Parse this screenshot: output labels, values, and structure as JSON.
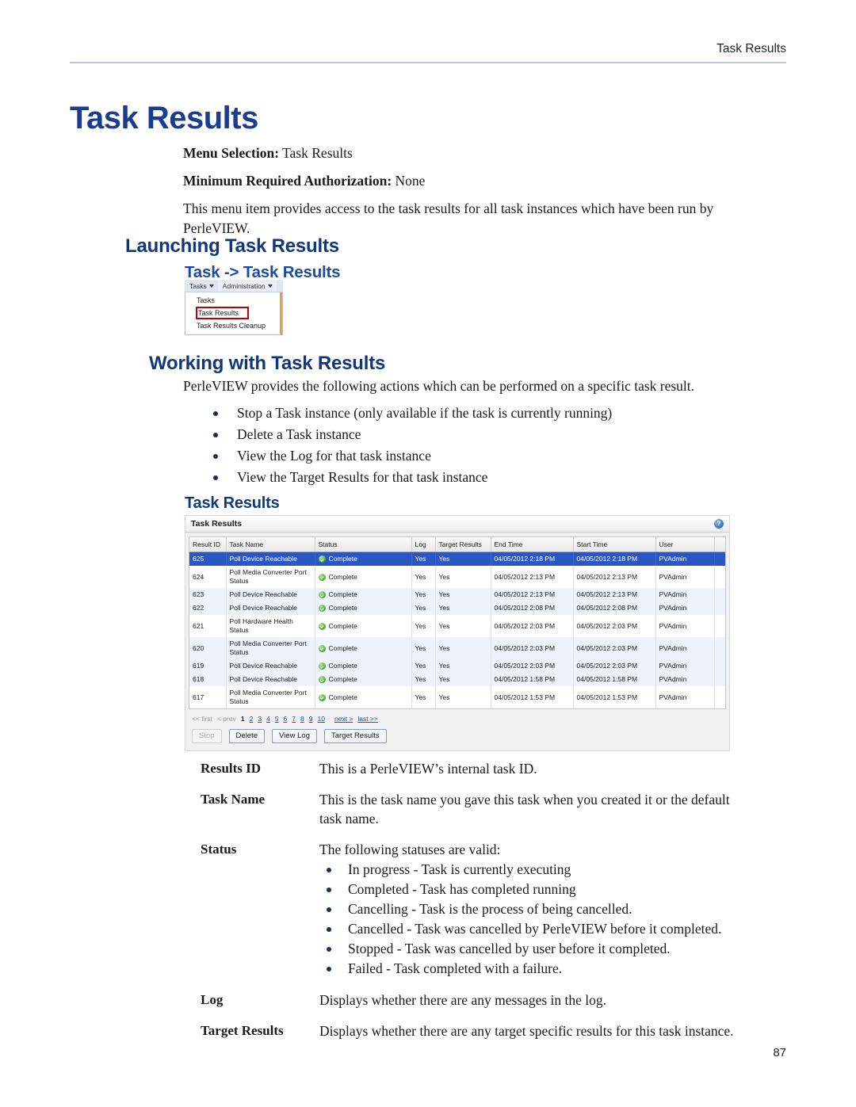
{
  "header": {
    "running_head": "Task Results"
  },
  "chapter": {
    "title": "Task Results"
  },
  "intro": {
    "menu_selection_label": "Menu Selection:",
    "menu_selection_value": " Task Results",
    "authorization_label": "Minimum Required Authorization:",
    "authorization_value": " None",
    "description": "This menu item provides access to the task results for all task instances which have been run by PerleVIEW."
  },
  "sections": {
    "launching": "Launching Task Results",
    "nav_path": "Task -> Task Results",
    "working_with": "Working with Task Results",
    "task_results": "Task Results"
  },
  "menu_mock": {
    "menubar": [
      {
        "label": "Tasks",
        "has_caret": true
      },
      {
        "label": "Administration",
        "has_caret": true
      }
    ],
    "dropdown_items": [
      {
        "label": "Tasks",
        "highlighted": false
      },
      {
        "label": "Task Results",
        "highlighted": true
      },
      {
        "label": "Task Results Cleanup",
        "highlighted": false
      }
    ],
    "highlight_color": "#c00000"
  },
  "working_with": {
    "lead": "PerleVIEW provides the following actions which can be performed on a specific task result.",
    "actions": [
      "Stop a Task instance (only available if the task is currently running)",
      "Delete a Task instance",
      "View the Log for that task instance",
      "View the Target Results for that task instance"
    ]
  },
  "app_shot": {
    "panel_title": "Task Results",
    "help_icon_glyph": "?",
    "columns": [
      "Result ID",
      "Task Name",
      "Status",
      "Log",
      "Target Results",
      "End Time",
      "Start Time",
      "User"
    ],
    "rows": [
      {
        "result_id": "625",
        "task_name": "Poll Device Reachable",
        "status": "Complete",
        "log": "Yes",
        "target_results": "Yes",
        "end_time": "04/05/2012 2:18 PM",
        "start_time": "04/05/2012 2:18 PM",
        "user": "PVAdmin",
        "selected": true
      },
      {
        "result_id": "624",
        "task_name": "Poll Media Converter Port Status",
        "status": "Complete",
        "log": "Yes",
        "target_results": "Yes",
        "end_time": "04/05/2012 2:13 PM",
        "start_time": "04/05/2012 2:13 PM",
        "user": "PVAdmin",
        "selected": false
      },
      {
        "result_id": "623",
        "task_name": "Poll Device Reachable",
        "status": "Complete",
        "log": "Yes",
        "target_results": "Yes",
        "end_time": "04/05/2012 2:13 PM",
        "start_time": "04/05/2012 2:13 PM",
        "user": "PVAdmin",
        "selected": false
      },
      {
        "result_id": "622",
        "task_name": "Poll Device Reachable",
        "status": "Complete",
        "log": "Yes",
        "target_results": "Yes",
        "end_time": "04/05/2012 2:08 PM",
        "start_time": "04/05/2012 2:08 PM",
        "user": "PVAdmin",
        "selected": false
      },
      {
        "result_id": "621",
        "task_name": "Poll Hardware Health Status",
        "status": "Complete",
        "log": "Yes",
        "target_results": "Yes",
        "end_time": "04/05/2012 2:03 PM",
        "start_time": "04/05/2012 2:03 PM",
        "user": "PVAdmin",
        "selected": false
      },
      {
        "result_id": "620",
        "task_name": "Poll Media Converter Port Status",
        "status": "Complete",
        "log": "Yes",
        "target_results": "Yes",
        "end_time": "04/05/2012 2:03 PM",
        "start_time": "04/05/2012 2:03 PM",
        "user": "PVAdmin",
        "selected": false
      },
      {
        "result_id": "619",
        "task_name": "Poll Device Reachable",
        "status": "Complete",
        "log": "Yes",
        "target_results": "Yes",
        "end_time": "04/05/2012 2:03 PM",
        "start_time": "04/05/2012 2:03 PM",
        "user": "PVAdmin",
        "selected": false
      },
      {
        "result_id": "618",
        "task_name": "Poll Device Reachable",
        "status": "Complete",
        "log": "Yes",
        "target_results": "Yes",
        "end_time": "04/05/2012 1:58 PM",
        "start_time": "04/05/2012 1:58 PM",
        "user": "PVAdmin",
        "selected": false
      },
      {
        "result_id": "617",
        "task_name": "Poll Media Converter Port Status",
        "status": "Complete",
        "log": "Yes",
        "target_results": "Yes",
        "end_time": "04/05/2012 1:53 PM",
        "start_time": "04/05/2012 1:53 PM",
        "user": "PVAdmin",
        "selected": false
      }
    ],
    "pager": {
      "first": "<< first",
      "prev": "< prev",
      "pages": [
        "1",
        "2",
        "3",
        "4",
        "5",
        "6",
        "7",
        "8",
        "9",
        "10"
      ],
      "current_page": "1",
      "next": "next >",
      "last": "last >>"
    },
    "buttons": [
      {
        "label": "Stop",
        "disabled": true
      },
      {
        "label": "Delete",
        "disabled": false
      },
      {
        "label": "View Log",
        "disabled": false
      },
      {
        "label": "Target Results",
        "disabled": false
      }
    ],
    "selected_row_color": "#2b57c4",
    "status_icon_color": "#3fa028"
  },
  "definitions": [
    {
      "term": "Results ID",
      "text": "This is a PerleVIEW’s internal task ID."
    },
    {
      "term": "Task Name",
      "text": "This is the task name you gave this task when you created it or the default task name."
    },
    {
      "term": "Status",
      "text": "The following statuses are valid:",
      "items": [
        "In progress - Task is currently executing",
        "Completed - Task has completed running",
        "Cancelling - Task is the process of being cancelled.",
        "Cancelled - Task was cancelled by PerleVIEW before it completed.",
        "Stopped - Task was cancelled by user before it completed.",
        "Failed - Task completed with a failure."
      ]
    },
    {
      "term": "Log",
      "text": "Displays whether there are any messages in the log."
    },
    {
      "term": "Target Results",
      "text": "Displays whether there are any target specific results for this task instance."
    }
  ],
  "folio": "87"
}
